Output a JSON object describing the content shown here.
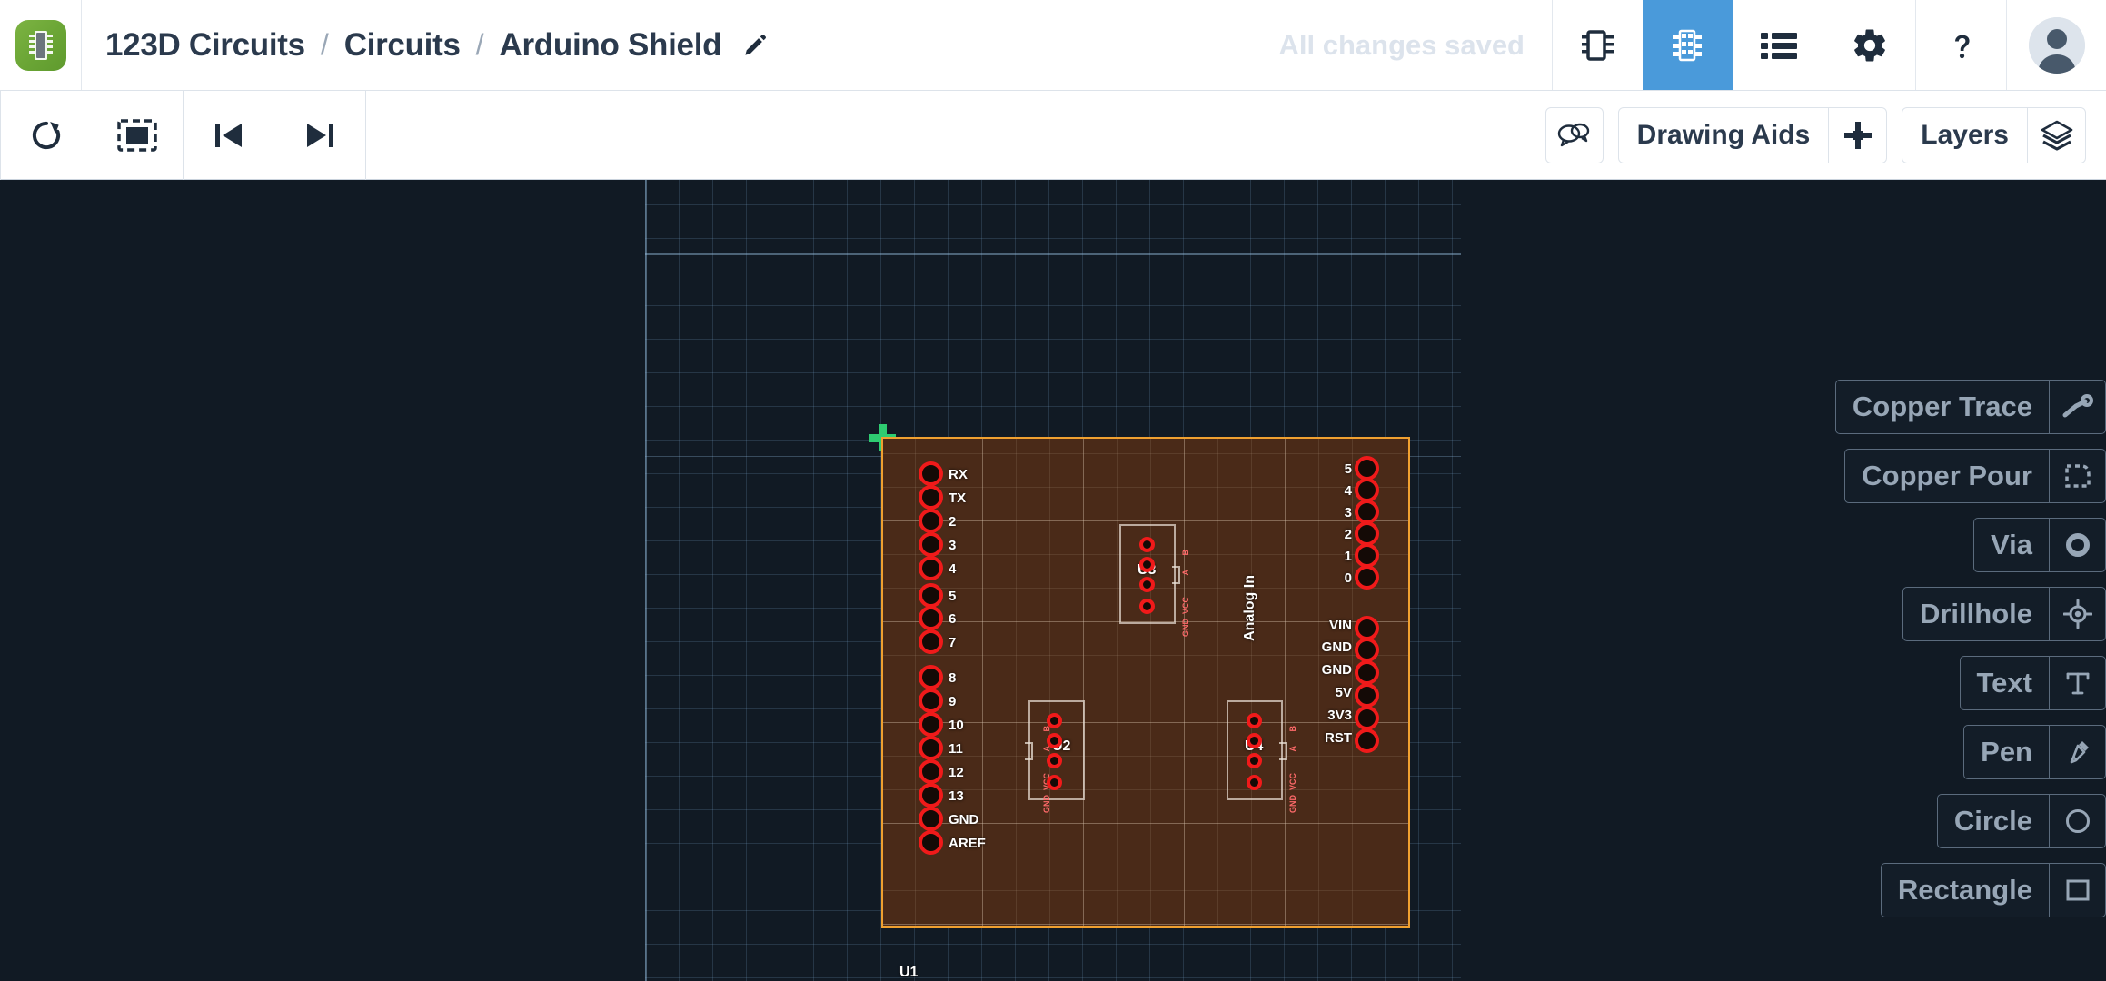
{
  "app": {
    "logo_icon": "chip-logo-icon",
    "accent_blue": "#4a9ada",
    "board_color": "#4a2a18",
    "board_outline": "#f0a030",
    "trace_color": "#e81e28",
    "pad_color": "#f01a1a",
    "origin_color": "#2ecc71",
    "canvas_bg": "#111a24"
  },
  "header": {
    "breadcrumb": {
      "root": "123D Circuits",
      "sep1": "/",
      "section": "Circuits",
      "sep2": "/",
      "document": "Arduino Shield",
      "edit_icon": "pencil-icon"
    },
    "status": "All changes saved",
    "icons": [
      {
        "name": "schematic-view-icon",
        "active": false
      },
      {
        "name": "pcb-view-icon",
        "active": true
      },
      {
        "name": "components-list-icon",
        "active": false
      },
      {
        "name": "settings-gear-icon",
        "active": false
      },
      {
        "name": "help-icon",
        "label": "?",
        "active": false
      }
    ],
    "avatar_icon": "user-avatar-icon"
  },
  "toolbar": {
    "left_tools": [
      {
        "name": "rotate-button",
        "icon": "rotate-cw-icon"
      },
      {
        "name": "select-area-button",
        "icon": "marquee-select-icon"
      }
    ],
    "nav_tools": [
      {
        "name": "skip-to-start-button",
        "icon": "skip-backward-icon"
      },
      {
        "name": "skip-to-end-button",
        "icon": "skip-forward-icon"
      }
    ],
    "comments_icon": "comments-icon",
    "drawing_aids": {
      "label": "Drawing Aids",
      "icon": "crosshair-icon"
    },
    "layers": {
      "label": "Layers",
      "icon": "layers-stack-icon"
    }
  },
  "palette": {
    "tools": [
      {
        "label": "Copper Trace",
        "icon": "copper-trace-icon"
      },
      {
        "label": "Copper Pour",
        "icon": "copper-pour-icon"
      },
      {
        "label": "Via",
        "icon": "via-icon"
      },
      {
        "label": "Drillhole",
        "icon": "drillhole-icon"
      },
      {
        "label": "Text",
        "icon": "text-tool-icon"
      },
      {
        "label": "Pen",
        "icon": "pen-tool-icon"
      },
      {
        "label": "Circle",
        "icon": "circle-tool-icon"
      },
      {
        "label": "Rectangle",
        "icon": "rectangle-tool-icon"
      }
    ]
  },
  "board": {
    "reference": "U1",
    "left_header_a": [
      "RX",
      "TX",
      "2",
      "3",
      "4",
      "5",
      "6",
      "7"
    ],
    "left_header_b": [
      "8",
      "9",
      "10",
      "11",
      "12",
      "13",
      "GND",
      "AREF"
    ],
    "right_group_title": "Analog In",
    "right_header_a": [
      "5",
      "4",
      "3",
      "2",
      "1",
      "0"
    ],
    "right_header_b": [
      "VIN",
      "GND",
      "GND",
      "5V",
      "3V3",
      "RST"
    ],
    "components": [
      {
        "ref": "U2",
        "pins": [
          "B",
          "A",
          "VCC",
          "GND"
        ]
      },
      {
        "ref": "U3",
        "pins": [
          "B",
          "A",
          "VCC",
          "GND"
        ]
      },
      {
        "ref": "U4",
        "pins": [
          "B",
          "A",
          "VCC",
          "GND"
        ]
      }
    ]
  }
}
